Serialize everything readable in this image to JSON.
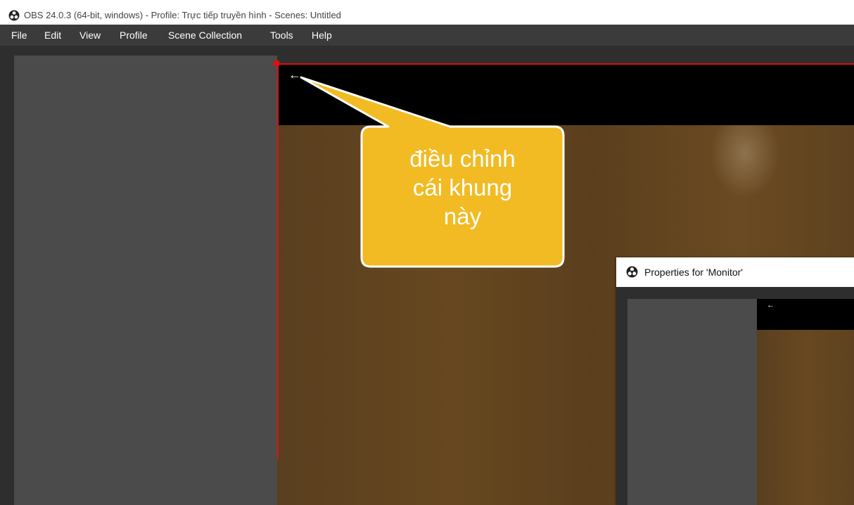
{
  "window": {
    "title": "OBS 24.0.3 (64-bit, windows) - Profile: Trực tiếp truyền hình - Scenes: Untitled",
    "app_icon": "obs-logo-icon"
  },
  "menu": {
    "items": [
      {
        "label": "File"
      },
      {
        "label": "Edit"
      },
      {
        "label": "View"
      },
      {
        "label": "Profile"
      },
      {
        "label": "Scene Collection"
      },
      {
        "label": "Tools"
      },
      {
        "label": "Help"
      }
    ]
  },
  "preview": {
    "back_arrow": "←",
    "selection_color": "#e01010"
  },
  "callout": {
    "lines": [
      "điều chỉnh",
      "cái khung",
      "này"
    ],
    "color": "#f2bb23"
  },
  "properties_dialog": {
    "title": "Properties for 'Monitor'",
    "back_arrow": "←"
  },
  "colors": {
    "menubar": "#3b3b3b",
    "panel": "#4b4b4b",
    "workspace": "#2e2e2e",
    "wood": "#5c4020"
  }
}
